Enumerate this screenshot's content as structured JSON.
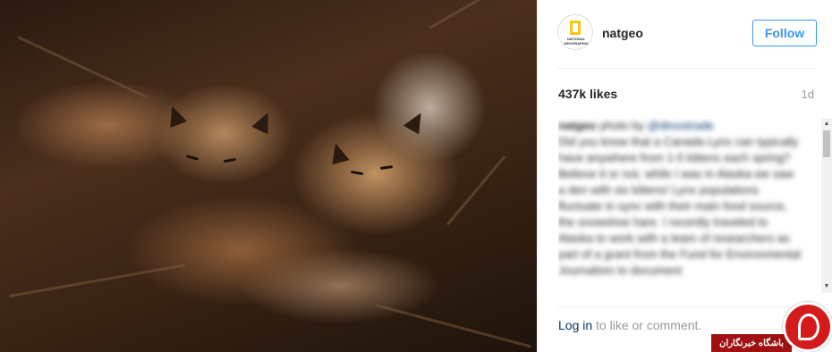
{
  "post": {
    "image_description_icon": "lynx-kittens-photo"
  },
  "account": {
    "username": "natgeo",
    "avatar_text": "NATIONAL GEOGRAPHIC",
    "follow_label": "Follow"
  },
  "stats": {
    "likes": "437k likes",
    "age": "1d"
  },
  "caption": {
    "author": "natgeo",
    "credit_prefix": "photo by",
    "credit_mention": "@dinostrade",
    "body": "Did you know that a Canada Lynx can typically have anywhere from 1-5 kittens each spring? Believe it or not, while I was in Alaska we saw a den with six kittens! Lynx populations fluctuate in sync with their main food source, the snowshoe hare. I recently traveled to Alaska to work with a team of researchers as part of a grant from the Fund for Environmental Journalism to document"
  },
  "comment_prompt": {
    "login_label": "Log in",
    "suffix": " to like or comment."
  },
  "scrollbar": {
    "up_arrow": "▲",
    "down_arrow": "▼"
  },
  "watermark": {
    "label": "باشگاه خبرنگاران"
  },
  "colors": {
    "accent": "#3897f0",
    "link": "#003569",
    "watermark_red": "#d31b1b"
  }
}
